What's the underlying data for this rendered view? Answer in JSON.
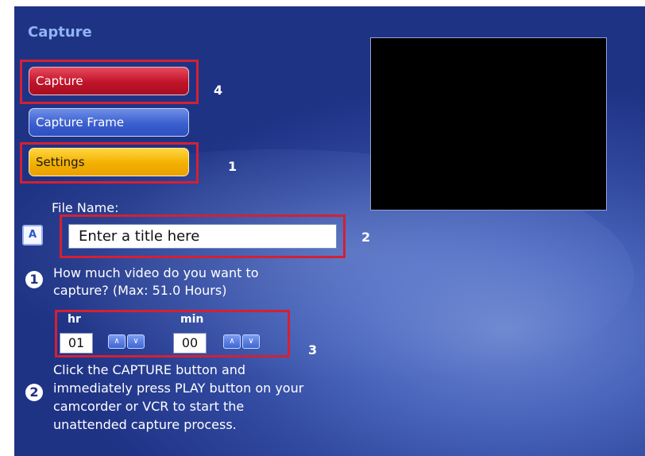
{
  "panel": {
    "title": "Capture"
  },
  "menu": {
    "capture_label": "Capture",
    "capture_frame_label": "Capture Frame",
    "settings_label": "Settings"
  },
  "annotations": {
    "settings_step": "1",
    "filename_step": "2",
    "duration_step": "3",
    "capture_step": "4"
  },
  "filename": {
    "label": "File Name:",
    "keyboard_icon_glyph": "A",
    "value": "Enter a title here"
  },
  "instructions": {
    "step1_number": "1",
    "step1_line1": "How much video do you want to",
    "step1_line2": "capture? (Max: 51.0 Hours)",
    "step2_number": "2",
    "step2_line1": "Click the CAPTURE button and",
    "step2_line2": "immediately press PLAY button on your",
    "step2_line3": "camcorder or VCR to start the",
    "step2_line4": "unattended capture process."
  },
  "duration": {
    "hr_label": "hr",
    "hr_value": "01",
    "min_label": "min",
    "min_value": "00",
    "up_glyph": "∧",
    "down_glyph": "∨"
  },
  "colors": {
    "highlight": "#d42033",
    "capture_button": "#c0142a",
    "frame_button": "#3b5fcf",
    "settings_button": "#f3b000",
    "background": "#2e469c"
  }
}
